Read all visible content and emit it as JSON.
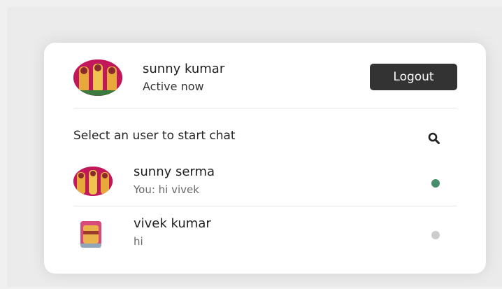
{
  "header": {
    "user_name": "sunny kumar",
    "user_status": "Active now",
    "logout_label": "Logout"
  },
  "search": {
    "label": "Select an user to start chat",
    "icon": "search-icon"
  },
  "users": [
    {
      "name": "sunny serma",
      "message": "You: hi vivek",
      "status": "online"
    },
    {
      "name": "vivek kumar",
      "message": "hi",
      "status": "offline"
    }
  ],
  "colors": {
    "online": "#468e6b",
    "offline": "#cccccc",
    "button_bg": "#333333",
    "avatar_bg": "#c2185b"
  }
}
